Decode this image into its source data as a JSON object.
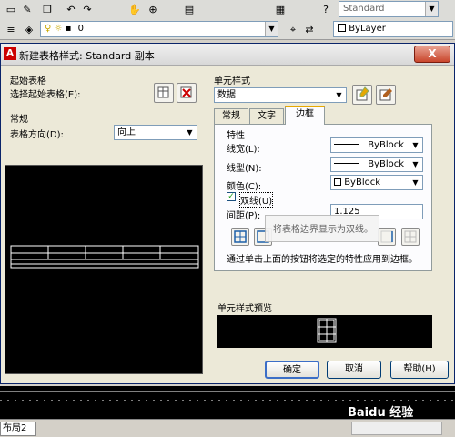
{
  "toolbar": {
    "layer_value": "0",
    "linetype_value": "ByLayer",
    "style_value": "Standard"
  },
  "dialog": {
    "title": "新建表格样式: Standard 副本",
    "close_label": "X",
    "start_table": {
      "section": "起始表格",
      "select_label": "选择起始表格(E):"
    },
    "general": {
      "section": "常规",
      "direction_label": "表格方向(D):",
      "direction_value": "向上"
    },
    "cell_style": {
      "section": "单元样式",
      "selected": "数据",
      "tabs": [
        "常规",
        "文字",
        "边框"
      ],
      "active_tab": "边框"
    },
    "border": {
      "properties_section": "特性",
      "lineweight_label": "线宽(L):",
      "lineweight_value": "ByBlock",
      "linetype_label": "线型(N):",
      "linetype_value": "ByBlock",
      "color_label": "颜色(C):",
      "color_value": "ByBlock",
      "double_label": "双线(U)",
      "spacing_label": "间距(P):",
      "spacing_value": "1.125",
      "tooltip": "将表格边界显示为双线。",
      "hint": "通过单击上面的按钮将选定的特性应用到边框。"
    },
    "preview_section": "单元样式预览",
    "buttons": {
      "ok": "确定",
      "cancel": "取消",
      "help": "帮助(H)"
    }
  },
  "status": {
    "layout_tab": "布局2"
  },
  "watermark": "Baidu 经验"
}
